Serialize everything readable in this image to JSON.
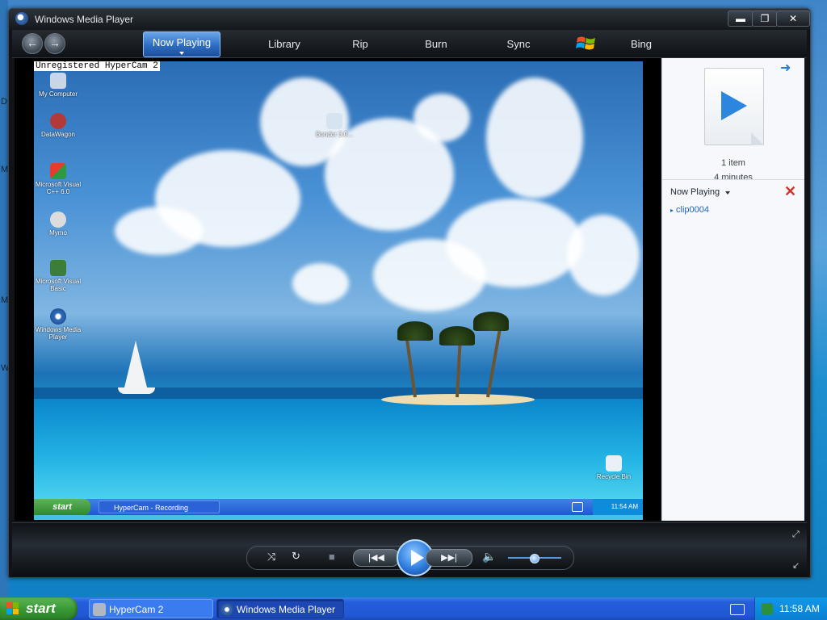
{
  "desktop": {
    "edge_letters": [
      "D",
      "M",
      "M",
      "W"
    ]
  },
  "window": {
    "title": "Windows Media Player",
    "controls": {
      "minimize": "▬",
      "maximize": "❐",
      "close": "✕"
    }
  },
  "nav": {
    "back_icon": "back-arrow-icon",
    "forward_icon": "forward-arrow-icon",
    "tabs": [
      {
        "label": "Now Playing",
        "active": true
      },
      {
        "label": "Library"
      },
      {
        "label": "Rip"
      },
      {
        "label": "Burn"
      },
      {
        "label": "Sync"
      },
      {
        "label": "Bing"
      }
    ]
  },
  "video": {
    "watermark": "Unregistered HyperCam 2",
    "desktop_icons": [
      {
        "label": "My Computer"
      },
      {
        "label": "DataWagon"
      },
      {
        "label": "Microsoft Visual C++ 6.0"
      },
      {
        "label": "Mymo"
      },
      {
        "label": "Microsoft Visual Basic"
      },
      {
        "label": "Windows Media Player"
      },
      {
        "label": "Bondor 3.0..."
      },
      {
        "label": "Recycle Bin"
      }
    ],
    "mini_taskbar": {
      "start": "start",
      "task": "HyperCam - Recording",
      "clock": "11:54 AM"
    }
  },
  "pane": {
    "count": "1 item",
    "duration": "4 minutes",
    "now_playing_label": "Now Playing",
    "items": [
      "clip0004"
    ]
  },
  "controls": {
    "shuffle": "⤨",
    "repeat": "↻",
    "stop": "■",
    "prev": "|◀◀",
    "next": "▶▶|",
    "volume_icon": "🔈",
    "volume_level": 0.5
  },
  "taskbar": {
    "start": "start",
    "tasks": [
      "HyperCam 2",
      "Windows Media Player"
    ],
    "clock": "11:58 AM"
  },
  "colors": {
    "accent": "#2d6cc3",
    "taskbar": "#245edb",
    "start": "#3a9a35"
  }
}
